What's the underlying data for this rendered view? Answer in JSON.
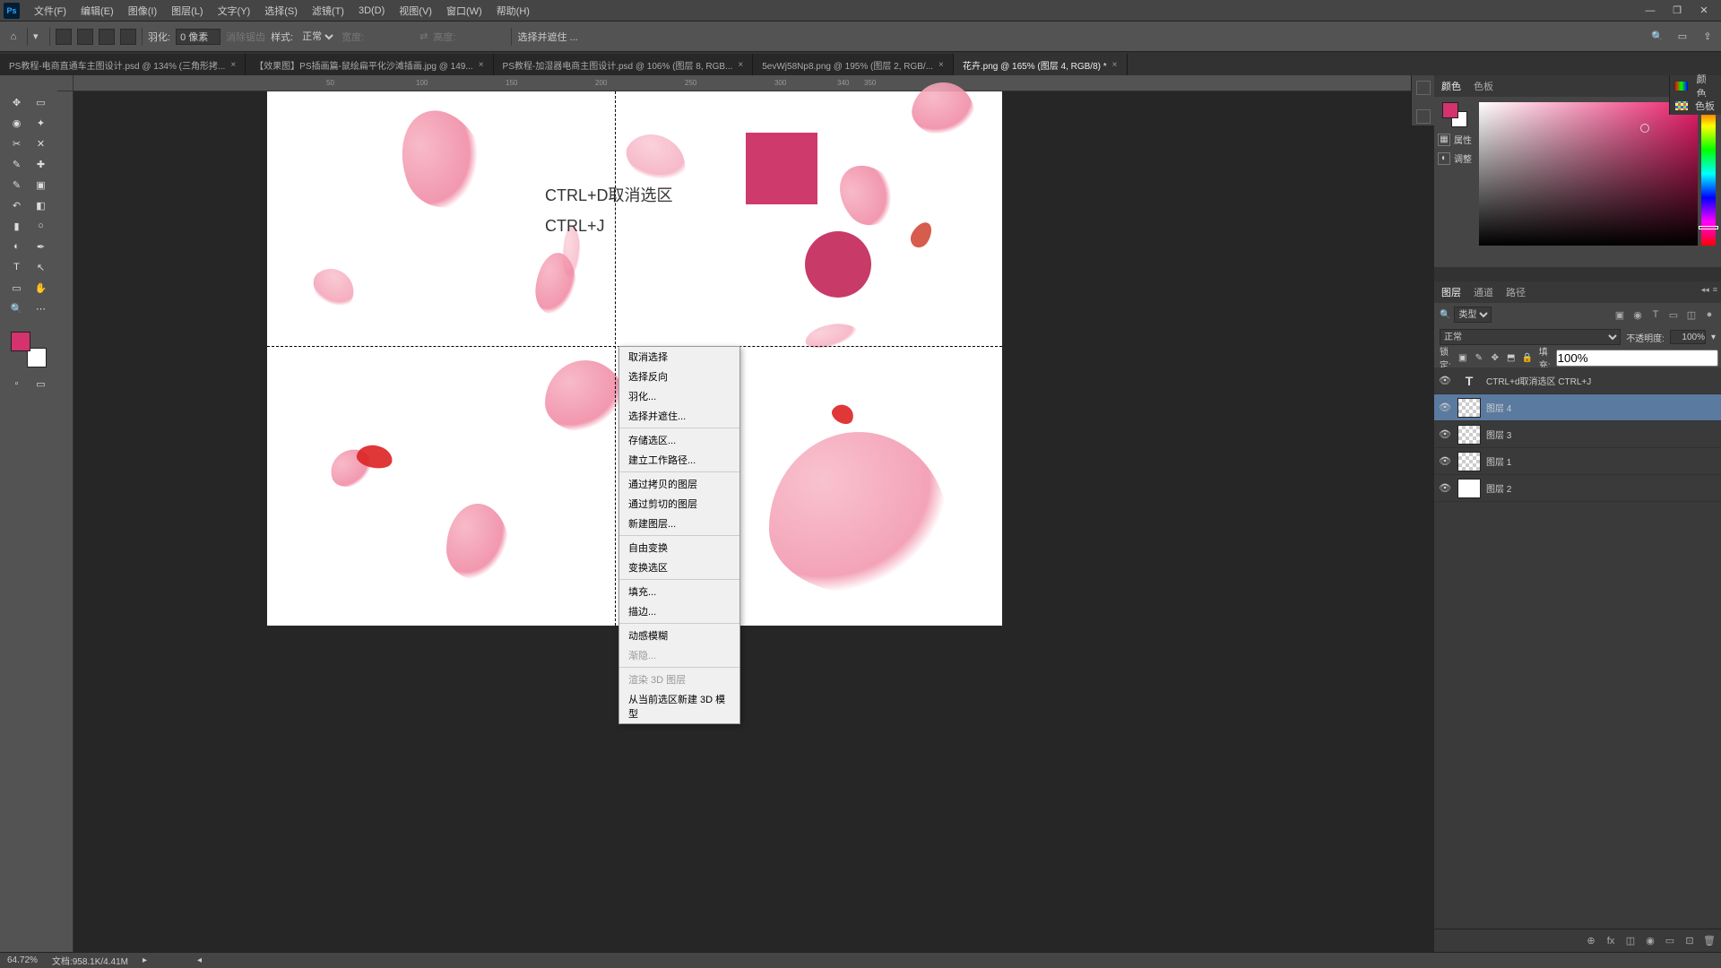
{
  "app": {
    "logo": "Ps"
  },
  "menu": [
    "文件(F)",
    "编辑(E)",
    "图像(I)",
    "图层(L)",
    "文字(Y)",
    "选择(S)",
    "滤镜(T)",
    "3D(D)",
    "视图(V)",
    "窗口(W)",
    "帮助(H)"
  ],
  "win_controls": {
    "min": "—",
    "max": "❐",
    "close": "✕"
  },
  "optbar": {
    "feather_label": "羽化:",
    "feather_value": "0 像素",
    "antialias": "消除锯齿",
    "style_label": "样式:",
    "style_value": "正常",
    "width_label": "宽度:",
    "swap_icon": "⇄",
    "height_label": "高度:",
    "select_mask": "选择并遮住 ..."
  },
  "tabs": [
    {
      "label": "PS教程-电商直通车主图设计.psd @ 134% (三角形拷...",
      "close": "×"
    },
    {
      "label": "【效果图】PS插画篇-鼠绘扁平化沙滩插画.jpg @ 149...",
      "close": "×"
    },
    {
      "label": "PS教程-加湿器电商主图设计.psd @ 106% (图层 8, RGB...",
      "close": "×"
    },
    {
      "label": "5evWj58Np8.png @ 195% (图层 2, RGB/...",
      "close": "×"
    },
    {
      "label": "花卉.png @ 165% (图层 4, RGB/8) *",
      "close": "×",
      "active": true
    }
  ],
  "ruler_ticks": [
    50,
    100,
    150,
    200,
    250,
    300,
    340,
    350
  ],
  "canvas": {
    "text1": "CTRL+D取消选区",
    "text2": "CTRL+J"
  },
  "context_menu": {
    "groups": [
      [
        "取消选择",
        "选择反向",
        "羽化...",
        "选择并遮住..."
      ],
      [
        "存储选区...",
        "建立工作路径..."
      ],
      [
        "通过拷贝的图层",
        "通过剪切的图层",
        "新建图层..."
      ],
      [
        "自由变换",
        "变换选区"
      ],
      [
        "填充...",
        "描边..."
      ],
      [
        "动感模糊"
      ]
    ],
    "disabled": [
      "渐隐..."
    ],
    "last_group": [
      "渲染 3D 图层",
      "从当前选区新建 3D 模型"
    ]
  },
  "right_panel_tabs1": [
    "颜色",
    "色板"
  ],
  "side_panel_items": [
    {
      "icon": "▦",
      "label": "属性"
    },
    {
      "icon": "◐",
      "label": "调整"
    }
  ],
  "secondary_color_tabs": {
    "icon_label": "颜色",
    "swatch_label": "色板"
  },
  "right_panel_tabs2": [
    "图层",
    "通道",
    "路径"
  ],
  "layers": {
    "filter_label": "类型",
    "filter_icons": [
      "▣",
      "◉",
      "T",
      "▭",
      "◫",
      "●"
    ],
    "blend_mode": "正常",
    "opacity_label": "不透明度:",
    "opacity_value": "100%",
    "lock_label": "锁定:",
    "lock_icons": [
      "▣",
      "✎",
      "✥",
      "⬒",
      "🔒"
    ],
    "fill_label": "填充:",
    "fill_value": "100%",
    "items": [
      {
        "type": "text",
        "name": "CTRL+d取消选区  CTRL+J"
      },
      {
        "type": "checker",
        "name": "图层 4",
        "selected": true
      },
      {
        "type": "checker",
        "name": "图层 3"
      },
      {
        "type": "checker",
        "name": "图层 1"
      },
      {
        "type": "white",
        "name": "图层 2"
      }
    ],
    "bottom_icons": [
      "⊕",
      "fx",
      "◫",
      "◉",
      "▭",
      "⊡",
      "🗑"
    ]
  },
  "status": {
    "zoom": "64.72%",
    "doc": "文档:958.1K/4.41M"
  },
  "tool_glyphs": {
    "move": "✥",
    "artboard": "▭",
    "lasso": "◉",
    "wand": "✦",
    "crop": "✂",
    "frame": "✕",
    "eyedrop": "✎",
    "heal": "✚",
    "brush": "✎",
    "stamp": "▣",
    "history": "↶",
    "eraser": "◧",
    "gradient": "▮",
    "blur": "○",
    "dodge": "◐",
    "pen": "✒",
    "text": "T",
    "path": "↖",
    "rect": "▭",
    "hand": "✋",
    "zoom": "🔍"
  }
}
